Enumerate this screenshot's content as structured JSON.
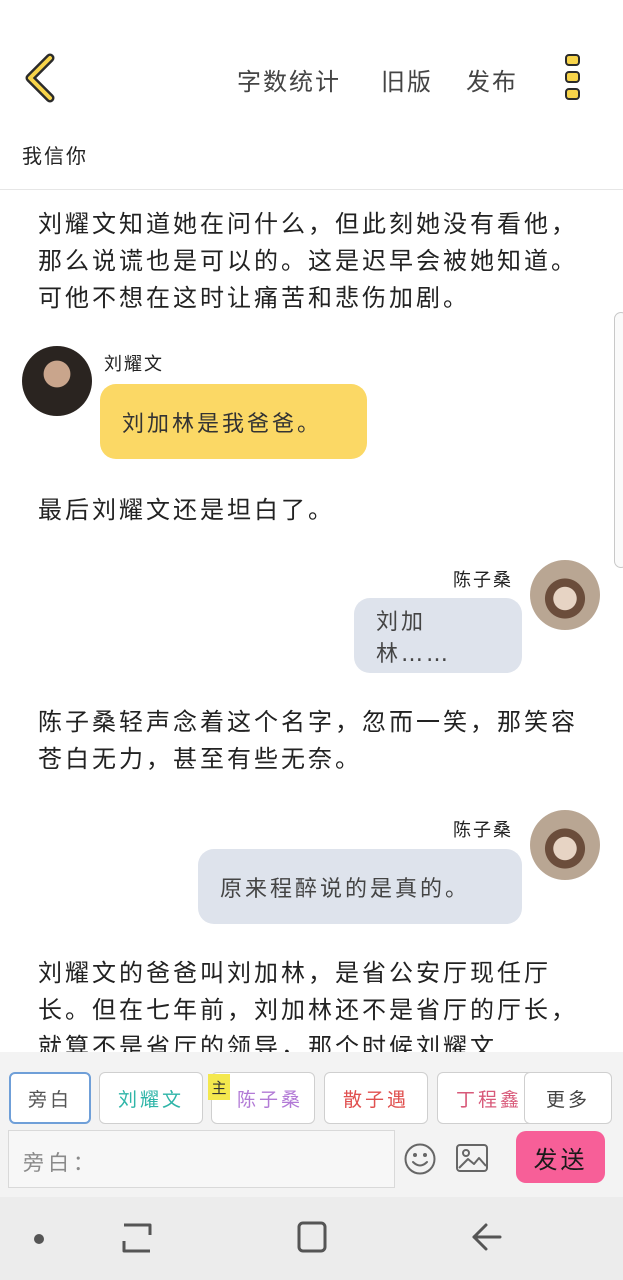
{
  "header": {
    "actions": [
      "字数统计",
      "旧版",
      "发布"
    ],
    "subtitle": "我信你"
  },
  "messages": [
    {
      "type": "narration",
      "text": "刘耀文知道她在问什么，但此刻她没有看他，那么说谎也是可以的。这是迟早会被她知道。可他不想在这时让痛苦和悲伤加剧。"
    },
    {
      "type": "dialogue",
      "side": "left",
      "speaker": "刘耀文",
      "text": "刘加林是我爸爸。"
    },
    {
      "type": "narration",
      "text": "最后刘耀文还是坦白了。"
    },
    {
      "type": "dialogue",
      "side": "right",
      "speaker": "陈子桑",
      "text": "刘加林……"
    },
    {
      "type": "narration",
      "text": "陈子桑轻声念着这个名字，忽而一笑，那笑容苍白无力，甚至有些无奈。"
    },
    {
      "type": "dialogue",
      "side": "right",
      "speaker": "陈子桑",
      "text": "原来程醉说的是真的。"
    },
    {
      "type": "narration",
      "text": "刘耀文的爸爸叫刘加林，是省公安厅现任厅长。但在七年前，刘加林还不是省厅的厅长，就算不是省厅的领导，那个时候刘耀文"
    }
  ],
  "roles": [
    {
      "label": "旁白",
      "color": "#555555",
      "active": true
    },
    {
      "label": "刘耀文",
      "color": "#2fb5a8"
    },
    {
      "label": "陈子桑",
      "color": "#b27ad6",
      "tag": "主"
    },
    {
      "label": "散子遇",
      "color": "#e0504f"
    },
    {
      "label": "丁程鑫",
      "color": "#d85a7a"
    },
    {
      "label": "更多",
      "color": "#444444"
    }
  ],
  "input": {
    "label": "旁白："
  },
  "send_label": "发送",
  "icons": {
    "back": "chevron-left-icon",
    "more": "more-vertical-icon",
    "emoji": "smiley-icon",
    "image": "image-icon"
  },
  "colors": {
    "accent_yellow": "#fbd865",
    "send_pink": "#f75f98",
    "bubble_gray": "#dee3ec"
  }
}
